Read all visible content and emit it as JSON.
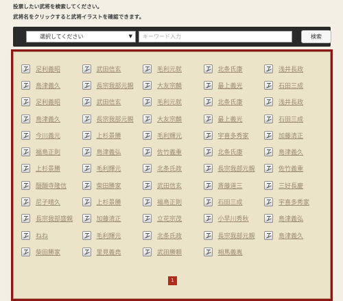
{
  "instructions": {
    "line1": "投票したい武将を検索してください。",
    "line2": "武将名をクリックすると武将イラストを確認できます。"
  },
  "search": {
    "select_value": "選択してください",
    "keyword_placeholder": "キーワード入力",
    "keyword_value": "",
    "button_label": "検索"
  },
  "generals": [
    [
      "足利義昭",
      "武田信玄",
      "毛利元就",
      "北条氏康",
      "浅井長政"
    ],
    [
      "島津義久",
      "長宗我部元親",
      "大友宗麟",
      "最上義光",
      "石田三成"
    ],
    [
      "足利義昭",
      "武田信玄",
      "毛利元就",
      "北条氏康",
      "浅井長政"
    ],
    [
      "島津義久",
      "長宗我部元親",
      "大友宗麟",
      "最上義光",
      "石田三成"
    ],
    [
      "今川義元",
      "上杉景勝",
      "毛利輝元",
      "宇喜多秀家",
      "加藤清正"
    ],
    [
      "福島正則",
      "島津義弘",
      "佐竹義重",
      "北条氏康",
      "島津義久"
    ],
    [
      "上杉景勝",
      "毛利輝元",
      "北条氏政",
      "長宗我部元親",
      "佐竹義重"
    ],
    [
      "醍醐寺隆信",
      "柴田勝家",
      "武田信玄",
      "斎藤道三",
      "三好長慶"
    ],
    [
      "尼子晴久",
      "上杉景勝",
      "福島正則",
      "石田三成",
      "宇喜多秀家"
    ],
    [
      "長宗我部盛親",
      "加藤清正",
      "立花宗茂",
      "小早川秀秋",
      "島津義弘"
    ],
    [
      "ねね",
      "毛利輝元",
      "北条氏政",
      "長宗我部元親",
      "島津義久"
    ],
    [
      "柴田勝家",
      "里見義堯",
      "武田勝頼",
      "相馬義胤",
      ""
    ]
  ],
  "pagination": {
    "current_page": "1"
  },
  "colors": {
    "panel_border": "#8b1717",
    "panel_bg": "#ece4c8",
    "page_active": "#b02c1d"
  },
  "icon_name": "general-avatar-icon"
}
